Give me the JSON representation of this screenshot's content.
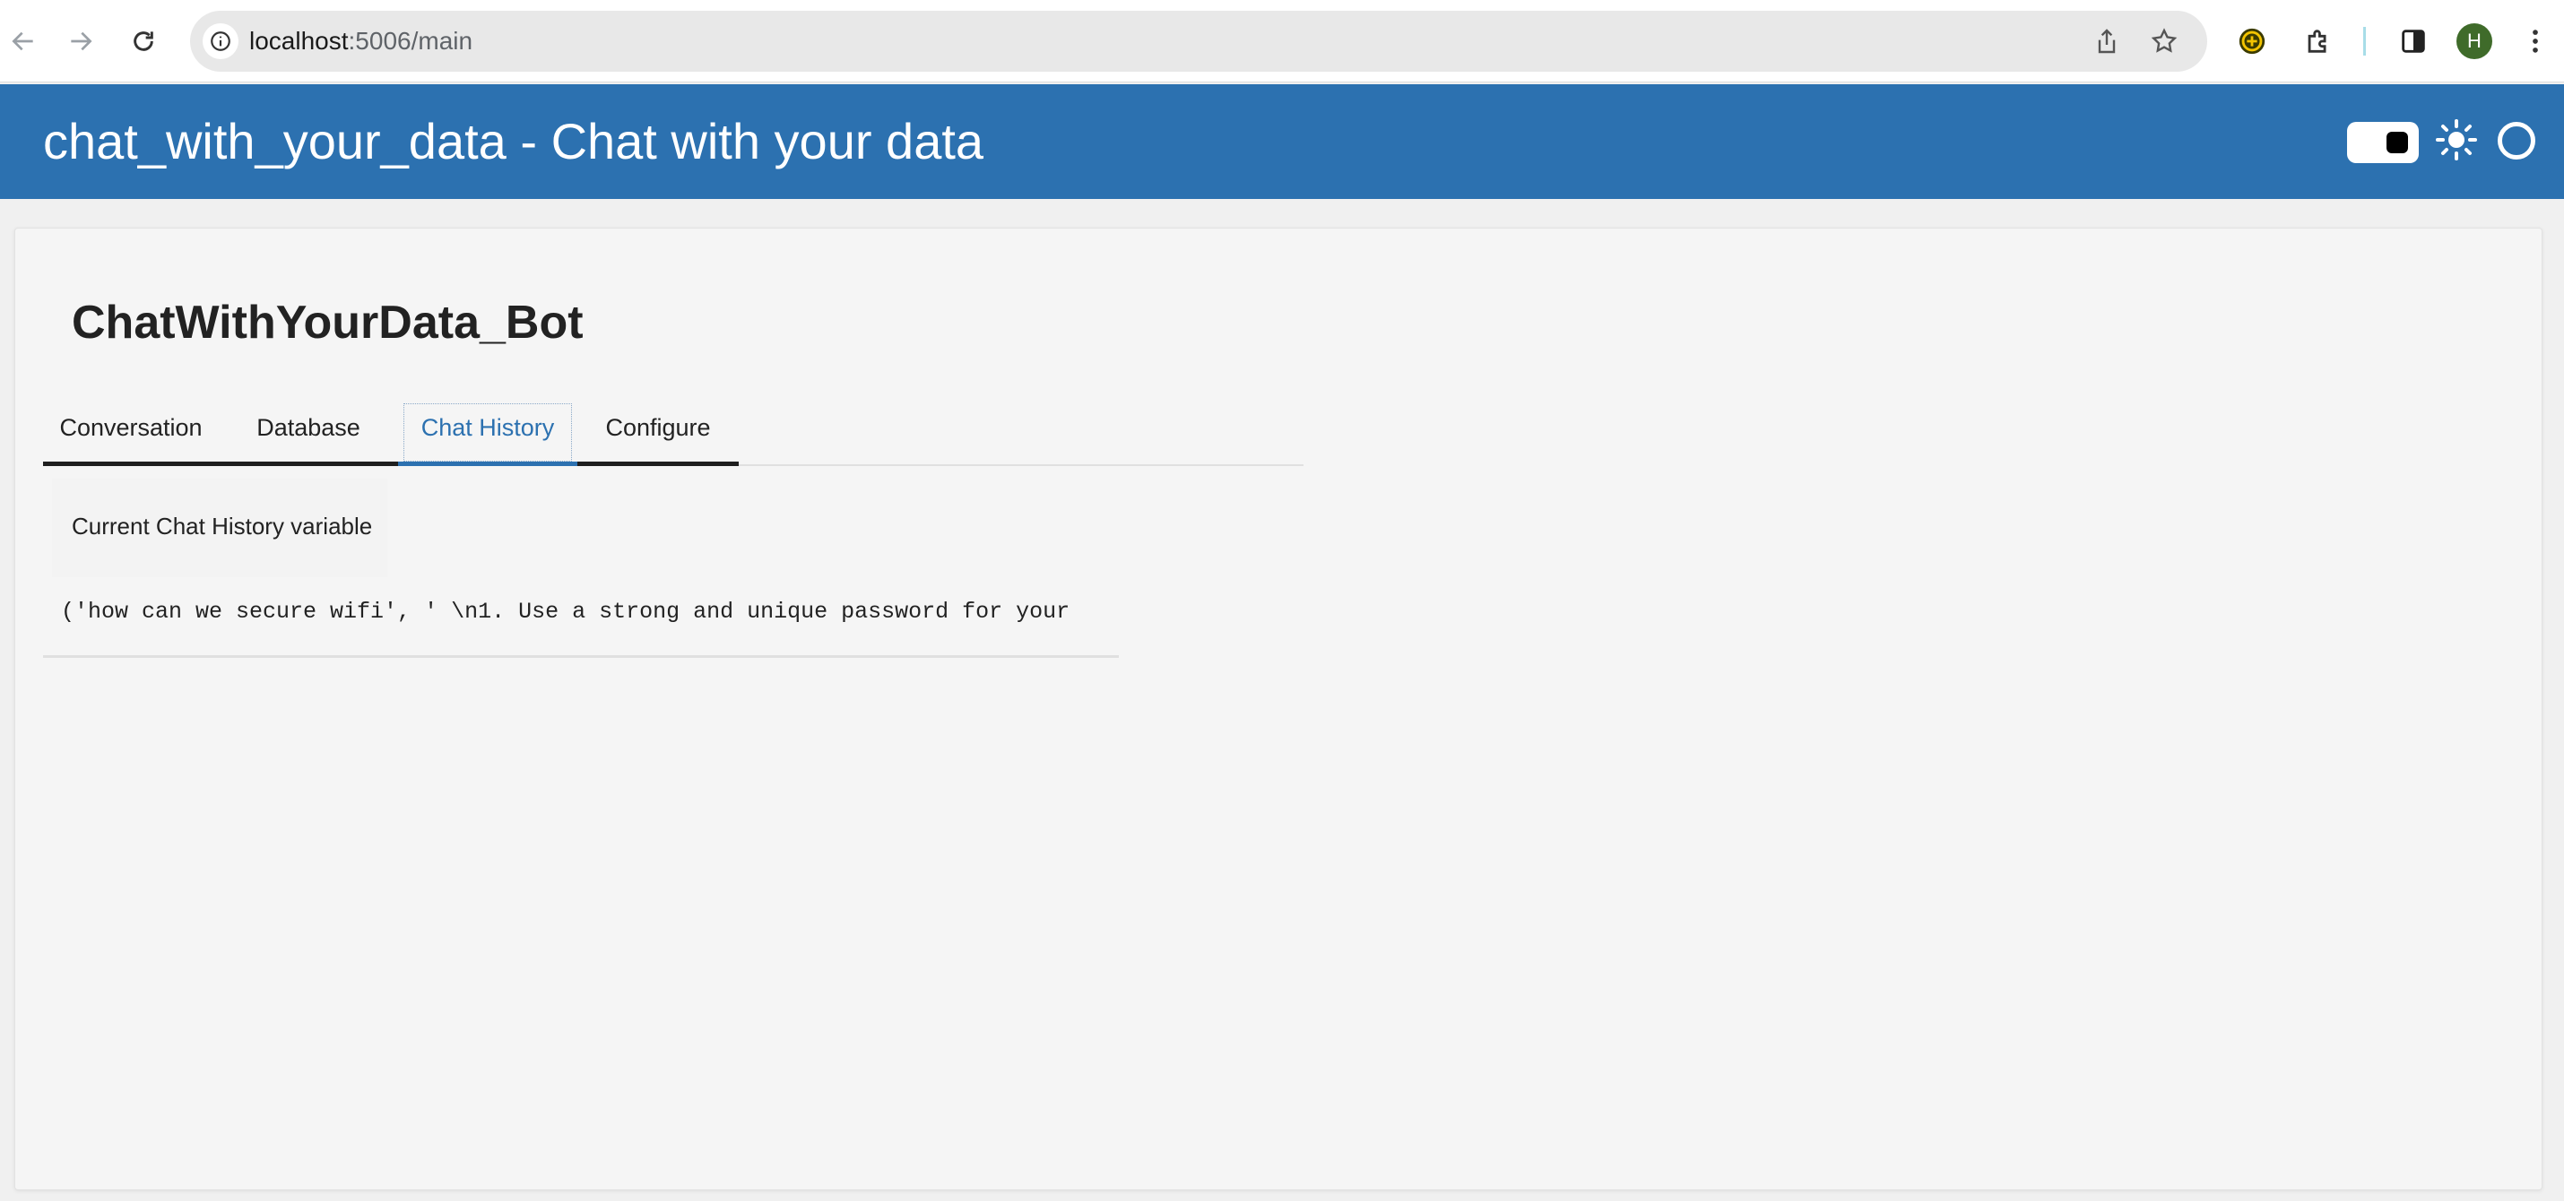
{
  "browser": {
    "url_host": "localhost",
    "url_path": ":5006/main",
    "avatar_letter": "H",
    "icons": [
      "back-arrow-icon",
      "forward-arrow-icon",
      "reload-icon",
      "info-icon",
      "share-icon",
      "star-icon",
      "extension-icon",
      "puzzle-icon",
      "side-panel-icon",
      "more-vert-icon"
    ]
  },
  "header": {
    "title": "chat_with_your_data  -  Chat with your data",
    "background_color": "#2c71b0"
  },
  "main": {
    "bot_title": "ChatWithYourData_Bot",
    "tabs": [
      {
        "label": "Conversation"
      },
      {
        "label": "Database"
      },
      {
        "label": "Chat History",
        "active": true
      },
      {
        "label": "Configure"
      }
    ],
    "panel": {
      "label": "Current Chat History variable",
      "history_text": "('how can we secure wifi', ' \\n1. Use a strong and unique password for your"
    }
  }
}
